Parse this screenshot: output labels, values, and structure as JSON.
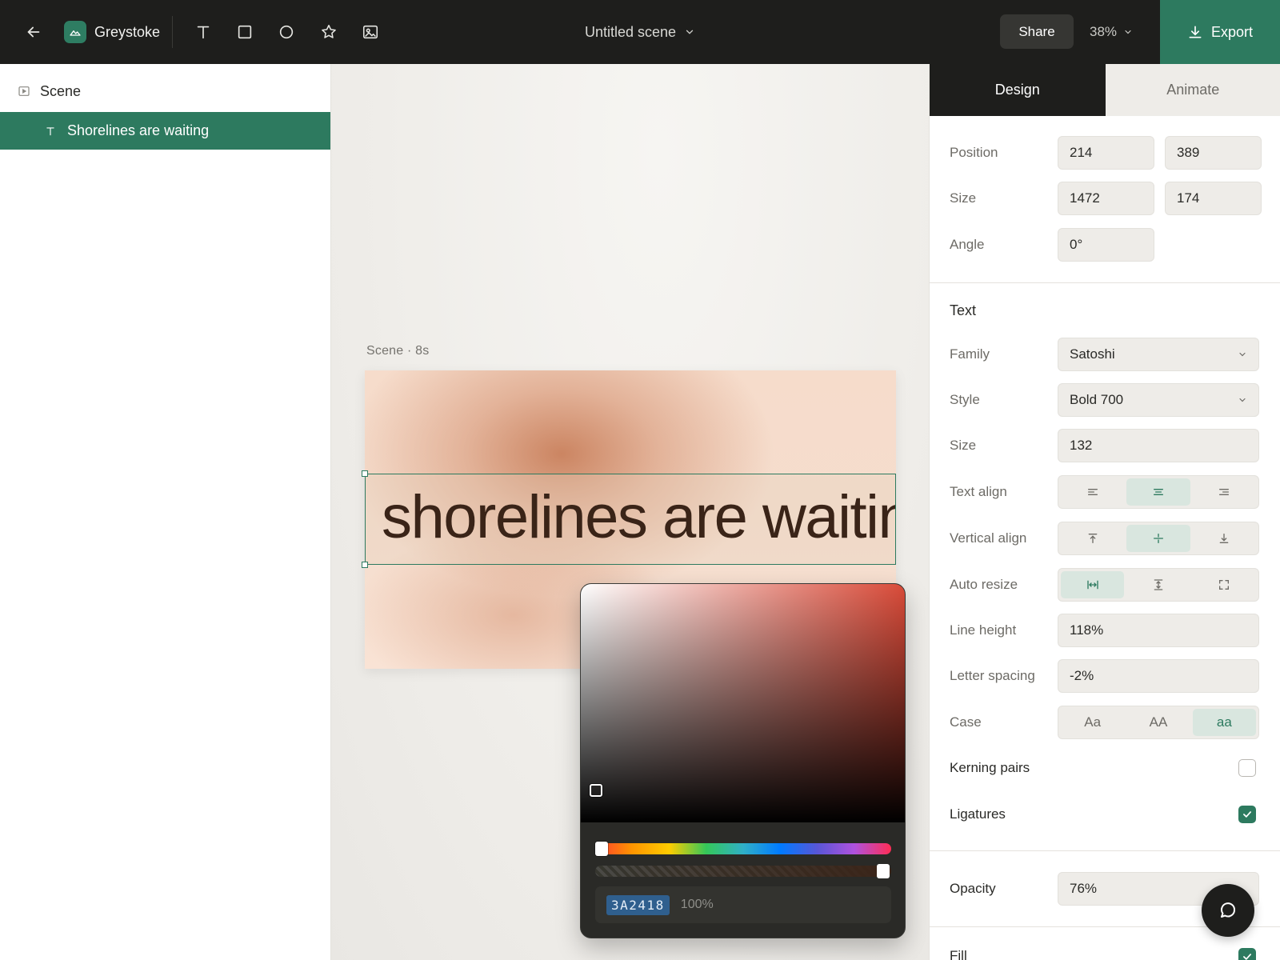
{
  "app": {
    "name": "Greystoke",
    "scene_title": "Untitled scene",
    "share_label": "Share",
    "zoom": "38%",
    "export_label": "Export"
  },
  "toolbar": {
    "tools": [
      "text-tool",
      "rectangle-tool",
      "ellipse-tool",
      "star-tool",
      "image-tool"
    ]
  },
  "layers": {
    "scene_label": "Scene",
    "text_layer_label": "Shorelines are waiting"
  },
  "canvas": {
    "scene_caption": "Scene · 8s",
    "scene_text": "shorelines are waiting"
  },
  "picker": {
    "hex": "3A2418",
    "alpha": "100%",
    "hue_color": "#d94a38"
  },
  "panel": {
    "tabs": {
      "design": "Design",
      "animate": "Animate"
    },
    "position": {
      "label": "Position",
      "x": "214",
      "y": "389"
    },
    "size": {
      "label": "Size",
      "w": "1472",
      "h": "174"
    },
    "angle": {
      "label": "Angle",
      "value": "0°"
    },
    "text_section": "Text",
    "family": {
      "label": "Family",
      "value": "Satoshi"
    },
    "style": {
      "label": "Style",
      "value": "Bold 700"
    },
    "font_size": {
      "label": "Size",
      "value": "132"
    },
    "text_align": {
      "label": "Text align",
      "selected": "center"
    },
    "vertical_align": {
      "label": "Vertical align",
      "selected": "middle"
    },
    "auto_resize": {
      "label": "Auto resize",
      "selected": "width"
    },
    "line_height": {
      "label": "Line height",
      "value": "118%"
    },
    "letter_spacing": {
      "label": "Letter spacing",
      "value": "-2%"
    },
    "case": {
      "label": "Case",
      "options": [
        "Aa",
        "AA",
        "aa"
      ],
      "selected": "aa"
    },
    "kerning": {
      "label": "Kerning pairs",
      "checked": false
    },
    "ligatures": {
      "label": "Ligatures",
      "checked": true
    },
    "opacity": {
      "label": "Opacity",
      "value": "76%"
    },
    "fill": {
      "label": "Fill",
      "checked": true
    }
  },
  "colors": {
    "accent": "#2d7a5f",
    "topbar": "#1e1e1c",
    "text_color": "#3a2418"
  }
}
